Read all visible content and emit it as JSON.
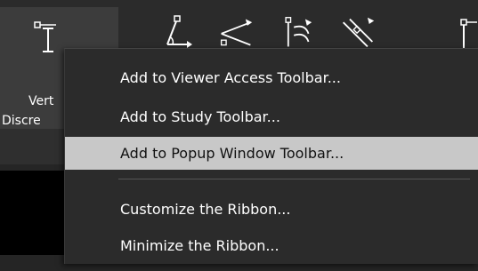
{
  "ribbon": {
    "selected_button_label_line1": "Vert",
    "selected_button_label_line2": "Discre",
    "icons": [
      "vertical-measure-icon",
      "angle-tool-icon",
      "cobb-angle-icon",
      "spine-label-icon",
      "diagonal-measure-icon",
      "pointer-tool-icon"
    ]
  },
  "context_menu": {
    "items": [
      {
        "label": "Add to Viewer Access Toolbar..."
      },
      {
        "label": "Add to Study Toolbar..."
      },
      {
        "label": "Add to Popup Window Toolbar..."
      },
      {
        "label": "Customize the Ribbon..."
      },
      {
        "label": "Minimize the Ribbon..."
      }
    ],
    "highlighted_index": 2
  },
  "colors": {
    "background": "#2b2b2b",
    "highlight": "#c8c8c8",
    "text": "#ffffff"
  }
}
